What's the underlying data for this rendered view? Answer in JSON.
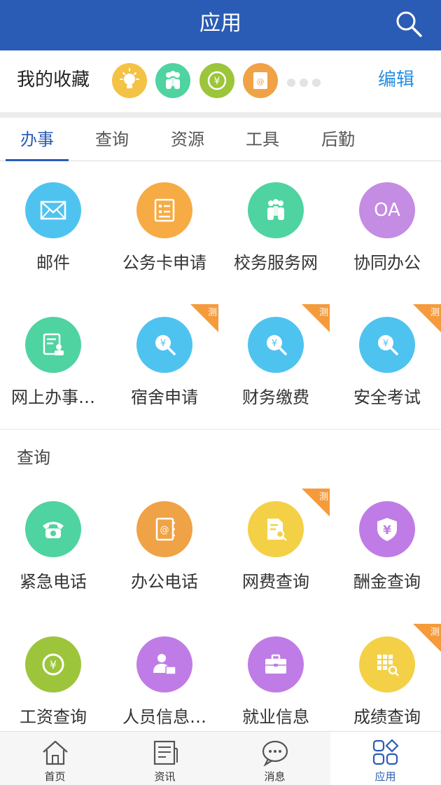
{
  "header": {
    "title": "应用"
  },
  "favorites": {
    "label": "我的收藏",
    "icons": [
      "lightbulb-icon",
      "people-icon",
      "yen-icon",
      "contacts-book-icon"
    ],
    "colors": [
      "#f4c244",
      "#4fd3a1",
      "#9cc53b",
      "#f0a246"
    ],
    "edit_label": "编辑"
  },
  "tabs": [
    "办事",
    "查询",
    "资源",
    "工具",
    "后勤"
  ],
  "active_tab": 0,
  "ban_shi": {
    "items": [
      {
        "label": "邮件",
        "icon": "mail-icon",
        "color": "#4fc3f0",
        "test": false
      },
      {
        "label": "公务卡申请",
        "icon": "form-icon",
        "color": "#f7ab45",
        "test": false
      },
      {
        "label": "校务服务网",
        "icon": "people-icon",
        "color": "#4fd3a1",
        "test": false
      },
      {
        "label": "协同办公",
        "icon": "oa-icon",
        "color": "#c48ce3",
        "test": false
      },
      {
        "label": "网上办事…",
        "icon": "document-person-icon",
        "color": "#4fd3a1",
        "test": false
      },
      {
        "label": "宿舍申请",
        "icon": "yen-search-icon",
        "color": "#4fc3f0",
        "test": true
      },
      {
        "label": "财务缴费",
        "icon": "yen-search-icon",
        "color": "#4fc3f0",
        "test": true
      },
      {
        "label": "安全考试",
        "icon": "yen-search-icon",
        "color": "#4fc3f0",
        "test": true
      }
    ]
  },
  "cha_xun": {
    "title": "查询",
    "items": [
      {
        "label": "紧急电话",
        "icon": "telephone-icon",
        "color": "#4fd3a1",
        "test": false
      },
      {
        "label": "办公电话",
        "icon": "contacts-book-icon",
        "color": "#f0a246",
        "test": false
      },
      {
        "label": "网费查询",
        "icon": "document-search-icon",
        "color": "#f4d046",
        "test": true
      },
      {
        "label": "酬金查询",
        "icon": "yen-shield-icon",
        "color": "#c07ce6",
        "test": false
      },
      {
        "label": "工资查询",
        "icon": "yen-icon",
        "color": "#9cc53b",
        "test": false
      },
      {
        "label": "人员信息…",
        "icon": "person-card-icon",
        "color": "#c07ce6",
        "test": false
      },
      {
        "label": "就业信息",
        "icon": "briefcase-icon",
        "color": "#c07ce6",
        "test": false
      },
      {
        "label": "成绩查询",
        "icon": "grid-search-icon",
        "color": "#f4d046",
        "test": true
      }
    ]
  },
  "badge_text": "测",
  "bottom_nav": {
    "items": [
      {
        "label": "首页",
        "icon": "home-icon"
      },
      {
        "label": "资讯",
        "icon": "news-icon"
      },
      {
        "label": "消息",
        "icon": "chat-icon"
      },
      {
        "label": "应用",
        "icon": "apps-icon"
      }
    ],
    "active": 3
  }
}
